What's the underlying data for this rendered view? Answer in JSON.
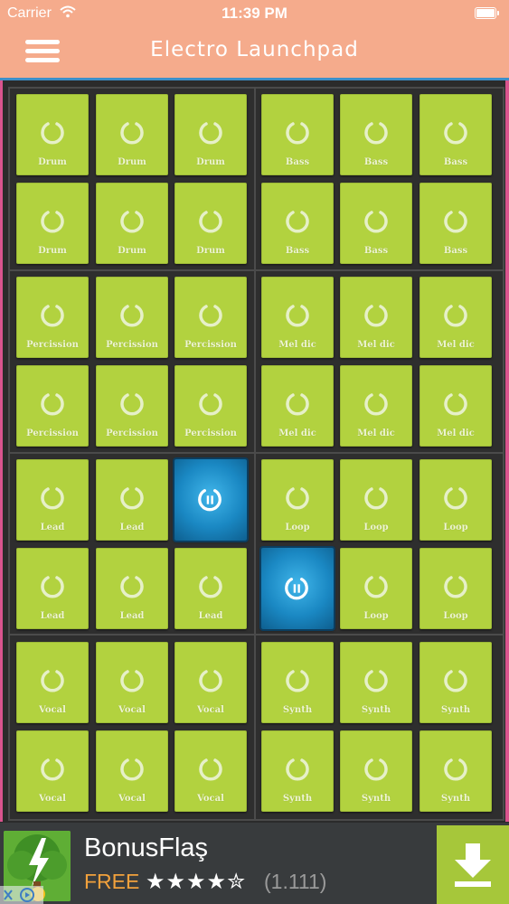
{
  "status_bar": {
    "carrier": "Carrier",
    "time": "11:39 PM"
  },
  "nav": {
    "title": "Electro Launchpad",
    "menu_icon": "hamburger-menu-icon"
  },
  "pad_icon": "loop-icon",
  "active_icon": "pause-icon",
  "colors": {
    "pad": "#b2d23f",
    "active_pad": "#1a88c3",
    "nav": "#f5ab8c",
    "board": "#2e2e2e"
  },
  "pads": [
    {
      "label": "Drum",
      "active": false
    },
    {
      "label": "Drum",
      "active": false
    },
    {
      "label": "Drum",
      "active": false
    },
    {
      "label": "Bass",
      "active": false
    },
    {
      "label": "Bass",
      "active": false
    },
    {
      "label": "Bass",
      "active": false
    },
    {
      "label": "Drum",
      "active": false
    },
    {
      "label": "Drum",
      "active": false
    },
    {
      "label": "Drum",
      "active": false
    },
    {
      "label": "Bass",
      "active": false
    },
    {
      "label": "Bass",
      "active": false
    },
    {
      "label": "Bass",
      "active": false
    },
    {
      "label": "Percission",
      "active": false
    },
    {
      "label": "Percission",
      "active": false
    },
    {
      "label": "Percission",
      "active": false
    },
    {
      "label": "Mel dic",
      "active": false
    },
    {
      "label": "Mel dic",
      "active": false
    },
    {
      "label": "Mel dic",
      "active": false
    },
    {
      "label": "Percission",
      "active": false
    },
    {
      "label": "Percission",
      "active": false
    },
    {
      "label": "Percission",
      "active": false
    },
    {
      "label": "Mel dic",
      "active": false
    },
    {
      "label": "Mel dic",
      "active": false
    },
    {
      "label": "Mel dic",
      "active": false
    },
    {
      "label": "Lead",
      "active": false
    },
    {
      "label": "Lead",
      "active": false
    },
    {
      "label": "",
      "active": true
    },
    {
      "label": "Loop",
      "active": false
    },
    {
      "label": "Loop",
      "active": false
    },
    {
      "label": "Loop",
      "active": false
    },
    {
      "label": "Lead",
      "active": false
    },
    {
      "label": "Lead",
      "active": false
    },
    {
      "label": "Lead",
      "active": false
    },
    {
      "label": "",
      "active": true
    },
    {
      "label": "Loop",
      "active": false
    },
    {
      "label": "Loop",
      "active": false
    },
    {
      "label": "Vocal",
      "active": false
    },
    {
      "label": "Vocal",
      "active": false
    },
    {
      "label": "Vocal",
      "active": false
    },
    {
      "label": "Synth",
      "active": false
    },
    {
      "label": "Synth",
      "active": false
    },
    {
      "label": "Synth",
      "active": false
    },
    {
      "label": "Vocal",
      "active": false
    },
    {
      "label": "Vocal",
      "active": false
    },
    {
      "label": "Vocal",
      "active": false
    },
    {
      "label": "Synth",
      "active": false
    },
    {
      "label": "Synth",
      "active": false
    },
    {
      "label": "Synth",
      "active": false
    }
  ],
  "ad": {
    "title": "BonusFlaş",
    "price": "FREE",
    "stars": "★★★★✮",
    "rating_count": "(1.111)",
    "download_icon": "download-arrow-icon",
    "app_icon": "lightning-tree-icon"
  }
}
